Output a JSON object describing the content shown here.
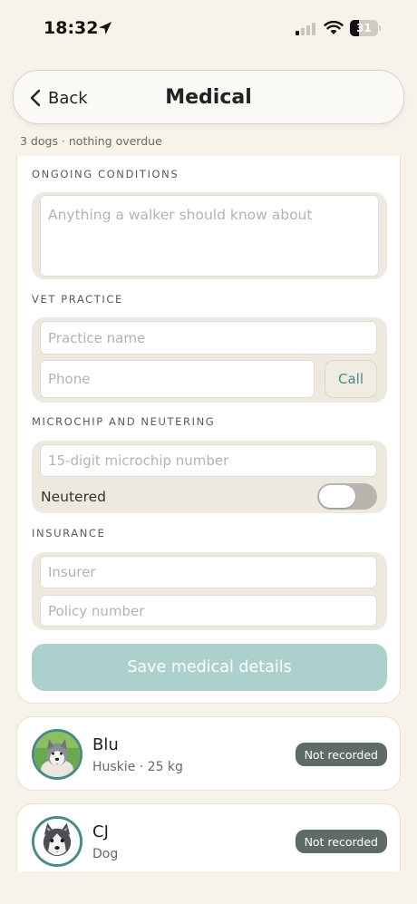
{
  "status_bar": {
    "time": "18:32",
    "battery": "31",
    "battery_level": 0.31
  },
  "nav": {
    "back_label": "Back",
    "title": "Medical"
  },
  "subtitle": "3 dogs · nothing overdue",
  "form": {
    "ongoing_conditions": {
      "label": "ONGOING CONDITIONS",
      "placeholder": "Anything a walker should know about"
    },
    "vet_practice": {
      "label": "VET PRACTICE",
      "practice_placeholder": "Practice name",
      "phone_placeholder": "Phone",
      "call_label": "Call"
    },
    "microchip": {
      "label": "MICROCHIP AND NEUTERING",
      "placeholder": "15-digit microchip number",
      "neutered_label": "Neutered",
      "neutered_on": false
    },
    "insurance": {
      "label": "INSURANCE",
      "insurer_placeholder": "Insurer",
      "policy_placeholder": "Policy number"
    },
    "save_label": "Save medical details"
  },
  "dogs": [
    {
      "name": "Blu",
      "details": "Huskie · 25 kg",
      "status": "Not recorded",
      "avatar_icon": "dog-photo-icon"
    },
    {
      "name": "CJ",
      "details": "Dog",
      "status": "Not recorded",
      "avatar_icon": "husky-illustration-icon"
    }
  ],
  "colors": {
    "accent": "#4a8a86",
    "save_button": "#acd1cc",
    "badge": "#5f6b69",
    "background": "#f7f2ea"
  }
}
